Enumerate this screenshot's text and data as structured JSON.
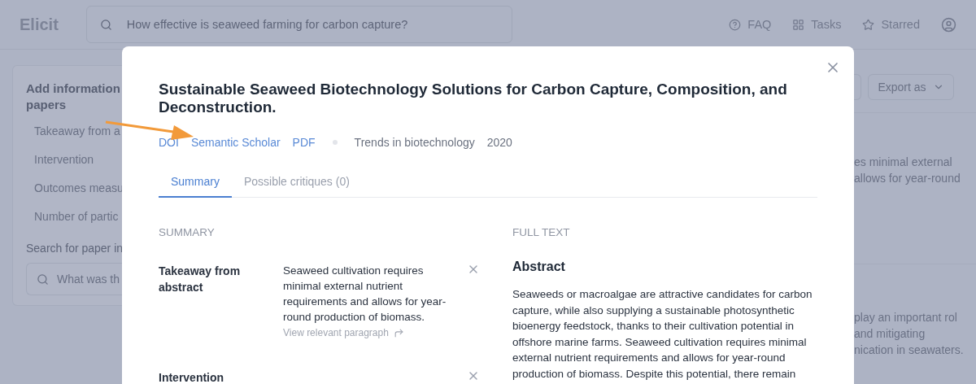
{
  "header": {
    "logo": "Elicit",
    "search": {
      "value": "How effective is seaweed farming for carbon capture?"
    },
    "nav": [
      {
        "kind": "help",
        "label": "FAQ"
      },
      {
        "kind": "grid",
        "label": "Tasks"
      },
      {
        "kind": "star",
        "label": "Starred"
      },
      {
        "kind": "user"
      }
    ]
  },
  "left_panel": {
    "title_lines": [
      "Add information",
      "papers"
    ],
    "items": [
      "Takeaway from a",
      "Intervention",
      "Outcomes measu",
      "Number of partic"
    ],
    "search_label": "Search for paper in",
    "search": {
      "placeholder": "What was th"
    }
  },
  "right_panel": {
    "export_button": "Export as",
    "snippets": [
      [
        "es minimal external",
        "allows for year-round"
      ],
      [
        "play an important rol",
        "and mitigating",
        "nication in seawaters."
      ]
    ]
  },
  "modal": {
    "title": "Sustainable Seaweed Biotechnology Solutions for Carbon Capture, Composition, and Deconstruction.",
    "links": [
      "DOI",
      "Semantic Scholar",
      "PDF"
    ],
    "journal": "Trends in biotechnology",
    "year": "2020",
    "tabs": [
      {
        "label": "Summary",
        "selected": true
      },
      {
        "label": "Possible critiques (0)",
        "selected": false
      }
    ],
    "summary": {
      "heading": "SUMMARY",
      "rows": [
        {
          "label": "Takeaway from abstract",
          "value": "Seaweed cultivation requires minimal external nutrient requirements and allows for year-round production of biomass.",
          "link": "View relevant paragraph"
        },
        {
          "label": "Intervention"
        }
      ]
    },
    "full_text": {
      "heading": "FULL TEXT",
      "section": "Abstract",
      "paragraph": "Seaweeds or macroalgae are attractive candidates for carbon capture, while also supplying a sustainable photosynthetic bioenergy feedstock, thanks to their cultivation potential in offshore marine farms. Seaweed cultivation requires minimal external nutrient requirements and allows for year-round production of biomass. Despite this potential, there remain"
    }
  }
}
